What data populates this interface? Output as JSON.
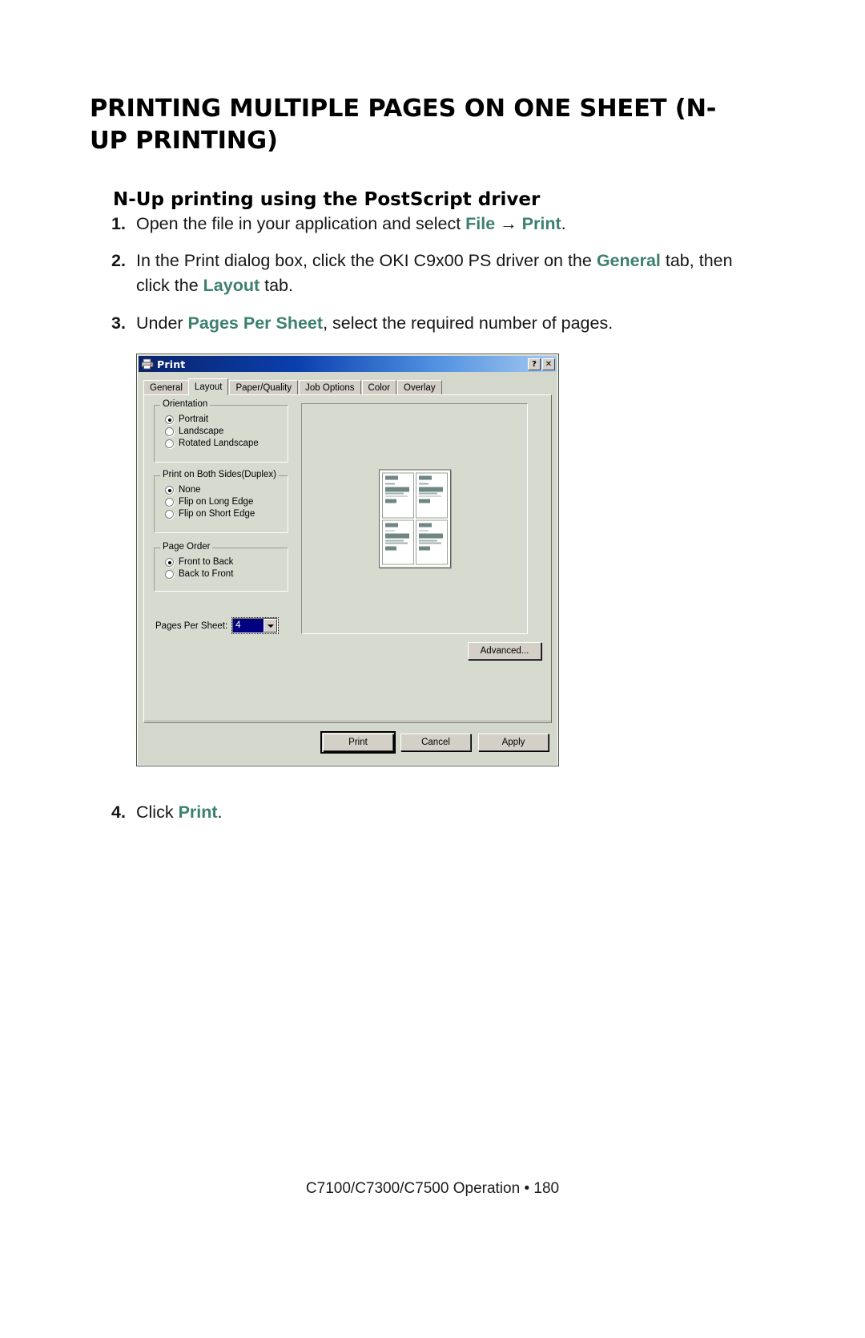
{
  "document": {
    "title": "PRINTING MULTIPLE PAGES ON ONE SHEET (N-UP PRINTING)",
    "subtitle": "N-Up printing using the PostScript driver",
    "footer": "C7100/C7300/C7500  Operation • 180",
    "accent_color": "#3d8070"
  },
  "steps": [
    {
      "num": "1.",
      "pre": "Open the file in your application and select ",
      "hl1": "File",
      "mid": " → ",
      "hl2": "Print",
      "post": "."
    },
    {
      "num": "2.",
      "pre": "In the Print dialog box, click the OKI C9x00 PS driver on the ",
      "hl1": "General",
      "mid": " tab, then click the ",
      "hl2": "Layout",
      "post": " tab."
    },
    {
      "num": "3.",
      "pre": "Under ",
      "hl1": "Pages Per Sheet",
      "mid": ", select the required number of pages.",
      "hl2": "",
      "post": ""
    },
    {
      "num": "4.",
      "pre": "Click ",
      "hl1": "Print",
      "mid": ".",
      "hl2": "",
      "post": ""
    }
  ],
  "dialog": {
    "title": "Print",
    "titlebar_icon": "printer-icon",
    "help_button": "?",
    "close_button": "✕",
    "tabs": [
      {
        "label": "General",
        "active": false
      },
      {
        "label": "Layout",
        "active": true
      },
      {
        "label": "Paper/Quality",
        "active": false
      },
      {
        "label": "Job Options",
        "active": false
      },
      {
        "label": "Color",
        "active": false
      },
      {
        "label": "Overlay",
        "active": false
      }
    ],
    "groups": {
      "orientation": {
        "legend": "Orientation",
        "options": [
          {
            "label": "Portrait",
            "selected": true
          },
          {
            "label": "Landscape",
            "selected": false
          },
          {
            "label": "Rotated Landscape",
            "selected": false
          }
        ]
      },
      "duplex": {
        "legend": "Print on Both Sides(Duplex)",
        "options": [
          {
            "label": "None",
            "selected": true
          },
          {
            "label": "Flip on Long Edge",
            "selected": false
          },
          {
            "label": "Flip on Short Edge",
            "selected": false
          }
        ]
      },
      "page_order": {
        "legend": "Page Order",
        "options": [
          {
            "label": "Front to Back",
            "selected": true
          },
          {
            "label": "Back to Front",
            "selected": false
          }
        ]
      }
    },
    "pages_per_sheet": {
      "label": "Pages Per Sheet:",
      "value": "4"
    },
    "advanced_button": "Advanced...",
    "footer_buttons": [
      {
        "label": "Print",
        "default": true
      },
      {
        "label": "Cancel",
        "default": false
      },
      {
        "label": "Apply",
        "default": false
      }
    ],
    "preview": {
      "pages_shown": 4,
      "layout": "2x2"
    }
  }
}
